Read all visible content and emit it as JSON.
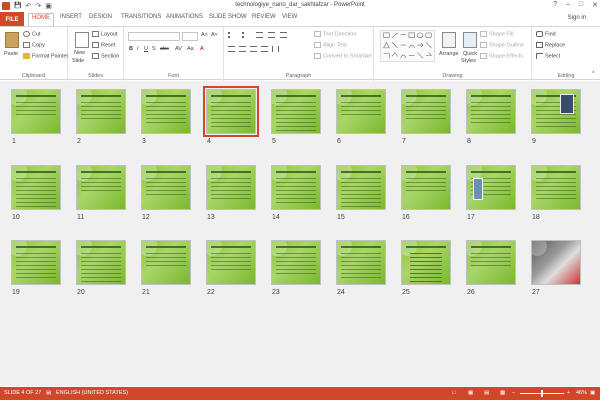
{
  "window": {
    "title": "technologiye_nano_dar_sakhtafzar - PowerPoint",
    "help": "?",
    "minimize": "–",
    "restore": "□",
    "close": "✕"
  },
  "qat": {
    "save": "💾",
    "undo": "↶",
    "redo": "↷",
    "start": "▣"
  },
  "tabs": [
    "FILE",
    "HOME",
    "INSERT",
    "DESIGN",
    "TRANSITIONS",
    "ANIMATIONS",
    "SLIDE SHOW",
    "REVIEW",
    "VIEW"
  ],
  "signin": "Sign in",
  "ribbon": {
    "clipboard": {
      "paste": "Paste",
      "cut": "Cut",
      "copy": "Copy",
      "format_painter": "Format Painter",
      "label": "Clipboard"
    },
    "slides": {
      "new_slide": "New",
      "new_slide2": "Slide",
      "layout": "Layout",
      "reset": "Reset",
      "section": "Section",
      "label": "Slides"
    },
    "font": {
      "label": "Font",
      "bold": "B",
      "italic": "I",
      "underline": "U",
      "strike": "S",
      "abc": "abc",
      "av": "AV",
      "aa": "Aa",
      "font_color": "A",
      "grow": "A˄",
      "shrink": "A˅"
    },
    "paragraph": {
      "text_direction": "Text Direction",
      "align_text": "Align Text",
      "convert_smartart": "Convert to SmartArt",
      "label": "Paragraph"
    },
    "drawing": {
      "arrange": "Arrange",
      "quick_styles": "Quick",
      "quick_styles2": "Styles",
      "shape_fill": "Shape Fill",
      "shape_outline": "Shape Outline",
      "shape_effects": "Shape Effects",
      "label": "Drawing"
    },
    "editing": {
      "find": "Find",
      "replace": "Replace",
      "select": "Select",
      "label": "Editing"
    }
  },
  "slides": [
    {
      "n": "1"
    },
    {
      "n": "2"
    },
    {
      "n": "3"
    },
    {
      "n": "4"
    },
    {
      "n": "5"
    },
    {
      "n": "6"
    },
    {
      "n": "7"
    },
    {
      "n": "8"
    },
    {
      "n": "9"
    },
    {
      "n": "10"
    },
    {
      "n": "11"
    },
    {
      "n": "12"
    },
    {
      "n": "13"
    },
    {
      "n": "14"
    },
    {
      "n": "15"
    },
    {
      "n": "16"
    },
    {
      "n": "17"
    },
    {
      "n": "18"
    },
    {
      "n": "19"
    },
    {
      "n": "20"
    },
    {
      "n": "21"
    },
    {
      "n": "22"
    },
    {
      "n": "23"
    },
    {
      "n": "24"
    },
    {
      "n": "25"
    },
    {
      "n": "26"
    },
    {
      "n": "27"
    }
  ],
  "selected_slide": 4,
  "status": {
    "slide_info": "SLIDE 4 OF 27",
    "language": "ENGLISH (UNITED STATES)",
    "zoom": "46%",
    "zoom_minus": "–",
    "zoom_plus": "+"
  },
  "colors": {
    "accent": "#d24726",
    "slide_green": "#8cc63f"
  }
}
